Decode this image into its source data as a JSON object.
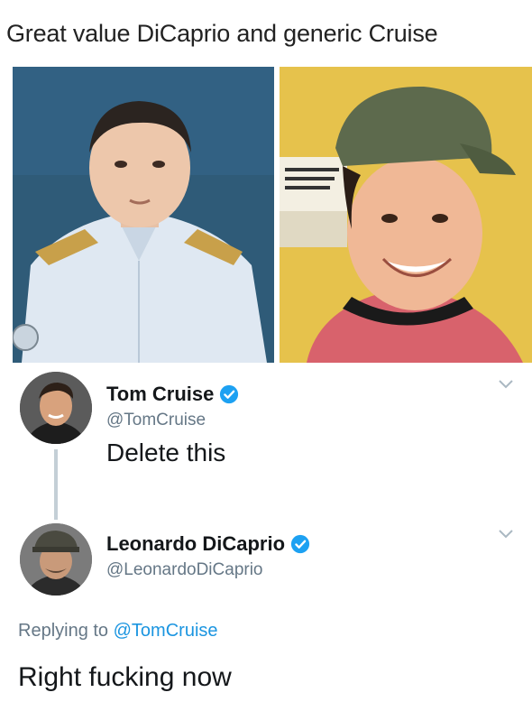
{
  "caption": "Great value DiCaprio and generic Cruise",
  "photos": [
    {
      "subject": "lookalike-dicaprio-uniform"
    },
    {
      "subject": "lookalike-cruise-cap"
    }
  ],
  "tweet1": {
    "name": "Tom Cruise",
    "handle": "@TomCruise",
    "text": "Delete this",
    "verified": true
  },
  "tweet2": {
    "name": "Leonardo DiCaprio",
    "handle": "@LeonardoDiCaprio",
    "replying_prefix": "Replying to",
    "replying_to": "@TomCruise",
    "text": "Right fucking now",
    "verified": true
  },
  "colors": {
    "verified": "#1da1f2",
    "mention": "#1b95e0",
    "handle": "#657786",
    "thread_line": "#c4cfd6"
  }
}
